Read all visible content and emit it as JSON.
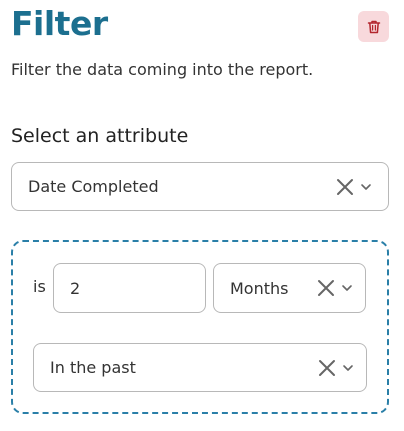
{
  "header": {
    "title": "Filter",
    "subtitle": "Filter the data coming into the report.",
    "delete_icon": "trash-icon",
    "delete_color": "#b3262e"
  },
  "attribute": {
    "label": "Select an attribute",
    "selected": "Date Completed"
  },
  "condition": {
    "operator": "is",
    "value": "2",
    "unit": "Months",
    "direction": "In the past"
  },
  "colors": {
    "title": "#1c6f8f",
    "dashed_border": "#2a7fa8",
    "delete_bg": "#f8d9dc"
  }
}
